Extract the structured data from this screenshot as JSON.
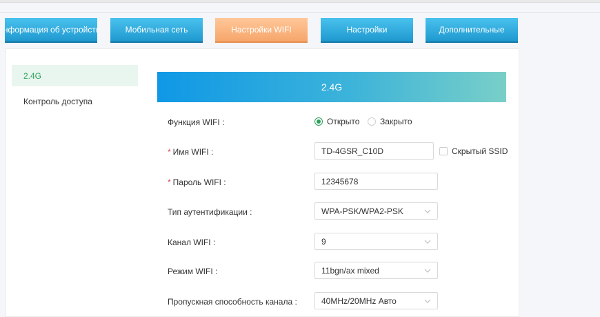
{
  "nav": {
    "tabs": [
      {
        "label": "Информация об устройстве"
      },
      {
        "label": "Мобильная сеть"
      },
      {
        "label": "Настройки WIFI"
      },
      {
        "label": "Настройки"
      },
      {
        "label": "Дополнительные"
      }
    ],
    "active_tab": "Настройки WIFI"
  },
  "sidebar": {
    "items": [
      {
        "label": "2.4G"
      },
      {
        "label": "Контроль доступа"
      }
    ],
    "active_item": "2.4G"
  },
  "banner": {
    "title": "2.4G"
  },
  "form": {
    "wifi_function": {
      "label": "Функция WIFI :",
      "options": [
        {
          "label": "Открыто"
        },
        {
          "label": "Закрыто"
        }
      ],
      "selected": "Открыто"
    },
    "wifi_name": {
      "required_mark": "*",
      "label": "Имя WIFI :",
      "value": "TD-4GSR_C10D"
    },
    "hidden_ssid": {
      "label": "Скрытый SSID",
      "checked": false
    },
    "wifi_password": {
      "required_mark": "*",
      "label": "Пароль WIFI :",
      "value": "12345678"
    },
    "auth_type": {
      "label": "Тип аутентификации :",
      "value": "WPA-PSK/WPA2-PSK"
    },
    "wifi_channel": {
      "label": "Канал WIFI :",
      "value": "9"
    },
    "wifi_mode": {
      "label": "Режим WIFI :",
      "value": "11bgn/ax mixed"
    },
    "bandwidth": {
      "label": "Пропускная способность канала :",
      "value": "40MHz/20MHz Авто"
    }
  },
  "colors": {
    "nav_blue": "#1f98cf",
    "nav_active_orange": "#f6a66a",
    "accent_green": "#2e9e5b",
    "required_red": "#e04848"
  },
  "icons": {
    "select_arrow": "chevron-down-icon"
  }
}
